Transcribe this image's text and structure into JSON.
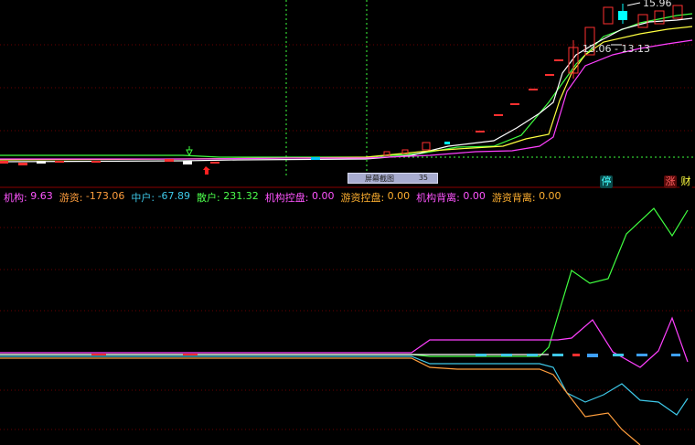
{
  "price_panel": {
    "high_label": "15.96",
    "range_label": "13.06 - 13.13"
  },
  "screenshot_bar": {
    "label": "屏幕截图",
    "count": "35"
  },
  "badges": {
    "stop": "停",
    "rise": "涨",
    "finance": "财"
  },
  "indicator_legend": {
    "items": [
      {
        "label": "机构: ",
        "value": "9.63",
        "color": "#ff55ff"
      },
      {
        "label": "  游资: ",
        "value": "-173.06",
        "color": "#ff9e3d"
      },
      {
        "label": "  中户: ",
        "value": "-67.89",
        "color": "#3ec8e8"
      },
      {
        "label": "  散户: ",
        "value": "231.32",
        "color": "#4cff4c"
      },
      {
        "label": "  机构控盘: ",
        "value": "0.00",
        "color": "#ff55ff"
      },
      {
        "label": "  游资控盘: ",
        "value": "0.00",
        "color": "#ffb030"
      },
      {
        "label": "  机构背离: ",
        "value": "0.00",
        "color": "#ff55ff"
      },
      {
        "label": "  游资背离: ",
        "value": "0.00",
        "color": "#ffb030"
      }
    ]
  },
  "colors": {
    "up": "#ff3030",
    "down": "#00ffff",
    "ma_white": "#ffffff",
    "ma_yellow": "#ffff40",
    "ma_magenta": "#ff40ff",
    "ma_green": "#40ff40",
    "grid": "#7a0000",
    "vline": "#3bff3b"
  },
  "chart_data": {
    "type": "line",
    "series": [
      {
        "values": [
          9.63
        ]
      },
      {
        "values": [
          -173.06
        ]
      },
      {
        "values": [
          -67.89
        ]
      },
      {
        "values": [
          231.32
        ]
      }
    ]
  }
}
